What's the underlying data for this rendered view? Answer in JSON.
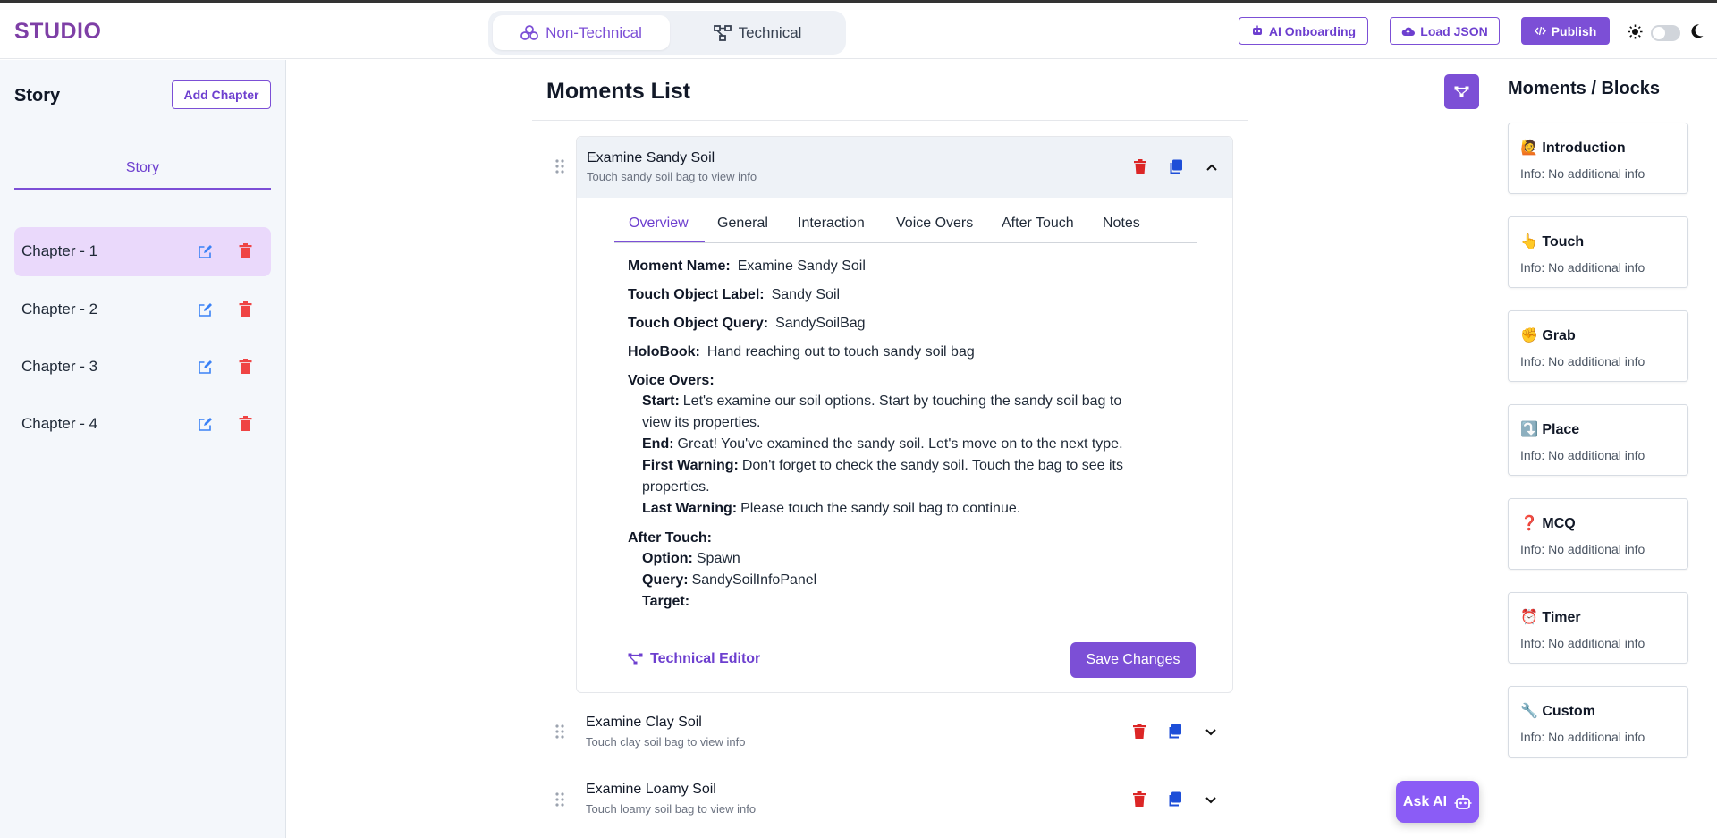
{
  "header": {
    "logo": "STUDIO",
    "mode_non_technical": "Non-Technical",
    "mode_technical": "Technical",
    "ai_onboarding": "AI Onboarding",
    "load_json": "Load JSON",
    "publish": "Publish"
  },
  "sidebar": {
    "title": "Story",
    "add_chapter": "Add Chapter",
    "tab": "Story",
    "chapters": [
      {
        "label": "Chapter - 1"
      },
      {
        "label": "Chapter - 2"
      },
      {
        "label": "Chapter - 3"
      },
      {
        "label": "Chapter - 4"
      }
    ]
  },
  "main": {
    "title": "Moments List",
    "moments": [
      {
        "title": "Examine Sandy Soil",
        "subtitle": "Touch sandy soil bag to view info"
      },
      {
        "title": "Examine Clay Soil",
        "subtitle": "Touch clay soil bag to view info"
      },
      {
        "title": "Examine Loamy Soil",
        "subtitle": "Touch loamy soil bag to view info"
      }
    ],
    "tabs": [
      "Overview",
      "General",
      "Interaction",
      "Voice Overs",
      "After Touch",
      "Notes"
    ],
    "overview": {
      "moment_name_label": "Moment Name:",
      "moment_name": "Examine Sandy Soil",
      "touch_label_label": "Touch Object Label:",
      "touch_label": "Sandy Soil",
      "touch_query_label": "Touch Object Query:",
      "touch_query": "SandySoilBag",
      "holobook_label": "HoloBook:",
      "holobook": "Hand reaching out to touch sandy soil bag",
      "voice_overs_label": "Voice Overs:",
      "start_label": "Start:",
      "start": "Let's examine our soil options. Start by touching the sandy soil bag to view its properties.",
      "end_label": "End:",
      "end": "Great! You've examined the sandy soil. Let's move on to the next type.",
      "first_warning_label": "First Warning:",
      "first_warning": "Don't forget to check the sandy soil. Touch the bag to see its properties.",
      "last_warning_label": "Last Warning:",
      "last_warning": "Please touch the sandy soil bag to continue.",
      "after_touch_label": "After Touch:",
      "option_label": "Option:",
      "option": "Spawn",
      "query_label": "Query:",
      "query": "SandySoilInfoPanel",
      "target_label": "Target:",
      "target": ""
    },
    "technical_editor": "Technical Editor",
    "save_changes": "Save Changes"
  },
  "right_panel": {
    "title": "Moments / Blocks",
    "blocks": [
      {
        "emoji": "🙋",
        "name": "Introduction",
        "info": "Info: No additional info"
      },
      {
        "emoji": "👆",
        "name": "Touch",
        "info": "Info: No additional info"
      },
      {
        "emoji": "✊",
        "name": "Grab",
        "info": "Info: No additional info"
      },
      {
        "emoji": "⤵️",
        "name": "Place",
        "info": "Info: No additional info"
      },
      {
        "emoji": "❓",
        "name": "MCQ",
        "info": "Info: No additional info"
      },
      {
        "emoji": "⏰",
        "name": "Timer",
        "info": "Info: No additional info"
      },
      {
        "emoji": "🔧",
        "name": "Custom",
        "info": "Info: No additional info"
      }
    ]
  },
  "ask_ai": "Ask AI",
  "colors": {
    "accent": "#7c4fd6",
    "logo": "#7e3fa6",
    "delete": "#dc2626",
    "copy": "#1d4ed8",
    "edit": "#3b82f6"
  }
}
